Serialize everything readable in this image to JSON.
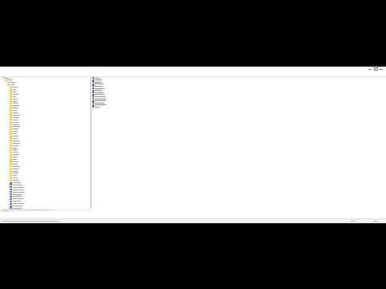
{
  "window": {
    "title": "",
    "menu": [
      "",
      "",
      "",
      "",
      ""
    ],
    "accent_color": "#e8c25a",
    "status_color": "#e8e060"
  },
  "tree": {
    "folder_icon": "folder-icon",
    "item_count": 57
  },
  "list": {
    "value_icon": "registry-value-icon",
    "item_count": 15
  },
  "statusbar": {
    "path": ""
  }
}
